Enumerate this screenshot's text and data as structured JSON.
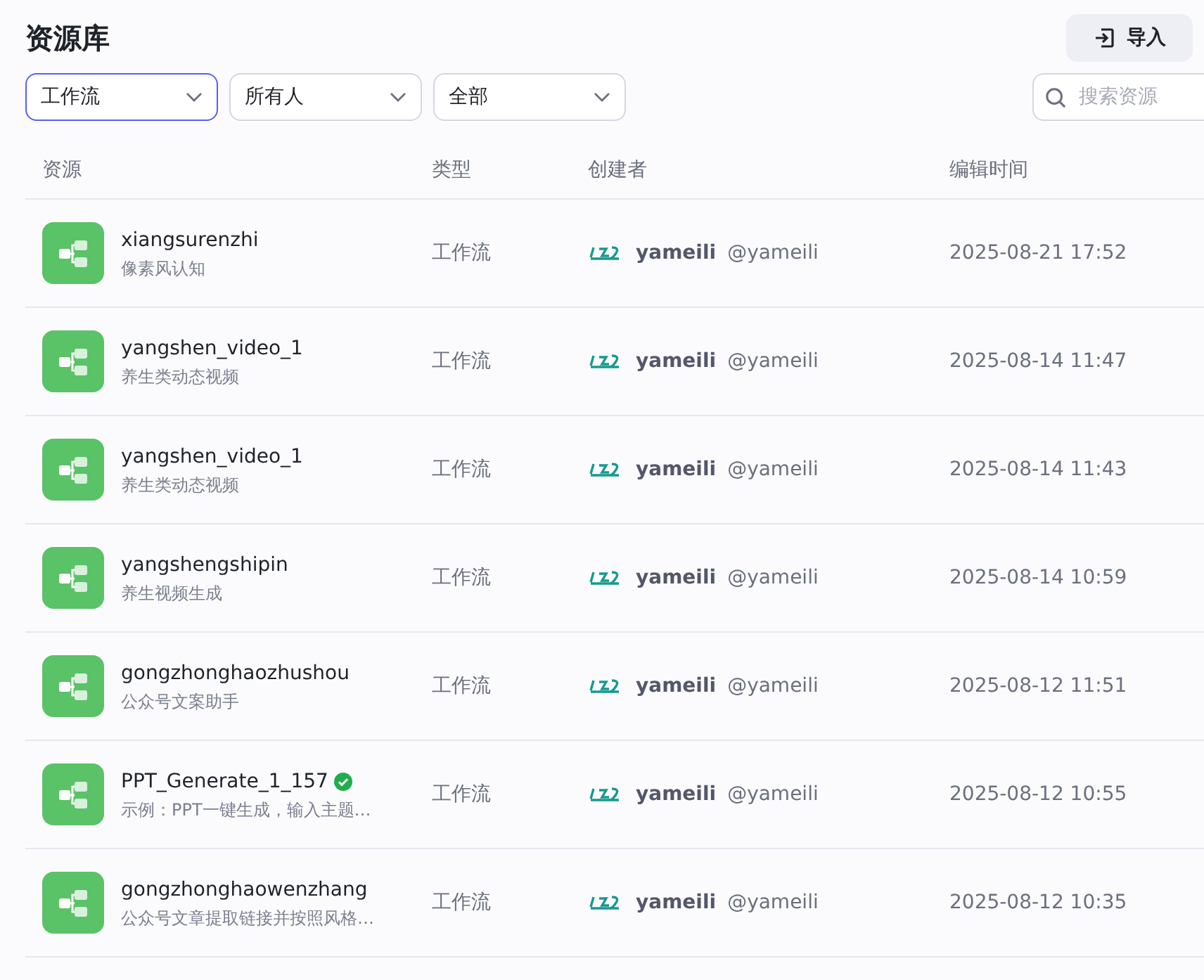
{
  "title": "资源库",
  "import_button": {
    "label": "导入"
  },
  "filters": [
    {
      "value": "工作流",
      "focused": true
    },
    {
      "value": "所有人",
      "focused": false
    },
    {
      "value": "全部",
      "focused": false
    }
  ],
  "search": {
    "placeholder": "搜索资源"
  },
  "table": {
    "columns": [
      "资源",
      "类型",
      "创建者",
      "编辑时间"
    ],
    "rows": [
      {
        "name": "xiangsurenzhi",
        "verified": false,
        "description": "像素风认知",
        "type": "工作流",
        "creator": "yameili",
        "handle": "@yameili",
        "edited": "2025-08-21 17:52"
      },
      {
        "name": "yangshen_video_1",
        "verified": false,
        "description": "养生类动态视频",
        "type": "工作流",
        "creator": "yameili",
        "handle": "@yameili",
        "edited": "2025-08-14 11:47"
      },
      {
        "name": "yangshen_video_1",
        "verified": false,
        "description": "养生类动态视频",
        "type": "工作流",
        "creator": "yameili",
        "handle": "@yameili",
        "edited": "2025-08-14 11:43"
      },
      {
        "name": "yangshengshipin",
        "verified": false,
        "description": "养生视频生成",
        "type": "工作流",
        "creator": "yameili",
        "handle": "@yameili",
        "edited": "2025-08-14 10:59"
      },
      {
        "name": "gongzhonghaozhushou",
        "verified": false,
        "description": "公众号文案助手",
        "type": "工作流",
        "creator": "yameili",
        "handle": "@yameili",
        "edited": "2025-08-12 11:51"
      },
      {
        "name": "PPT_Generate_1_157",
        "verified": true,
        "description": "示例：PPT一键生成，输入主题…",
        "type": "工作流",
        "creator": "yameili",
        "handle": "@yameili",
        "edited": "2025-08-12 10:55"
      },
      {
        "name": "gongzhonghaowenzhang",
        "verified": false,
        "description": "公众号文章提取链接并按照风格…",
        "type": "工作流",
        "creator": "yameili",
        "handle": "@yameili",
        "edited": "2025-08-12 10:35"
      }
    ]
  }
}
